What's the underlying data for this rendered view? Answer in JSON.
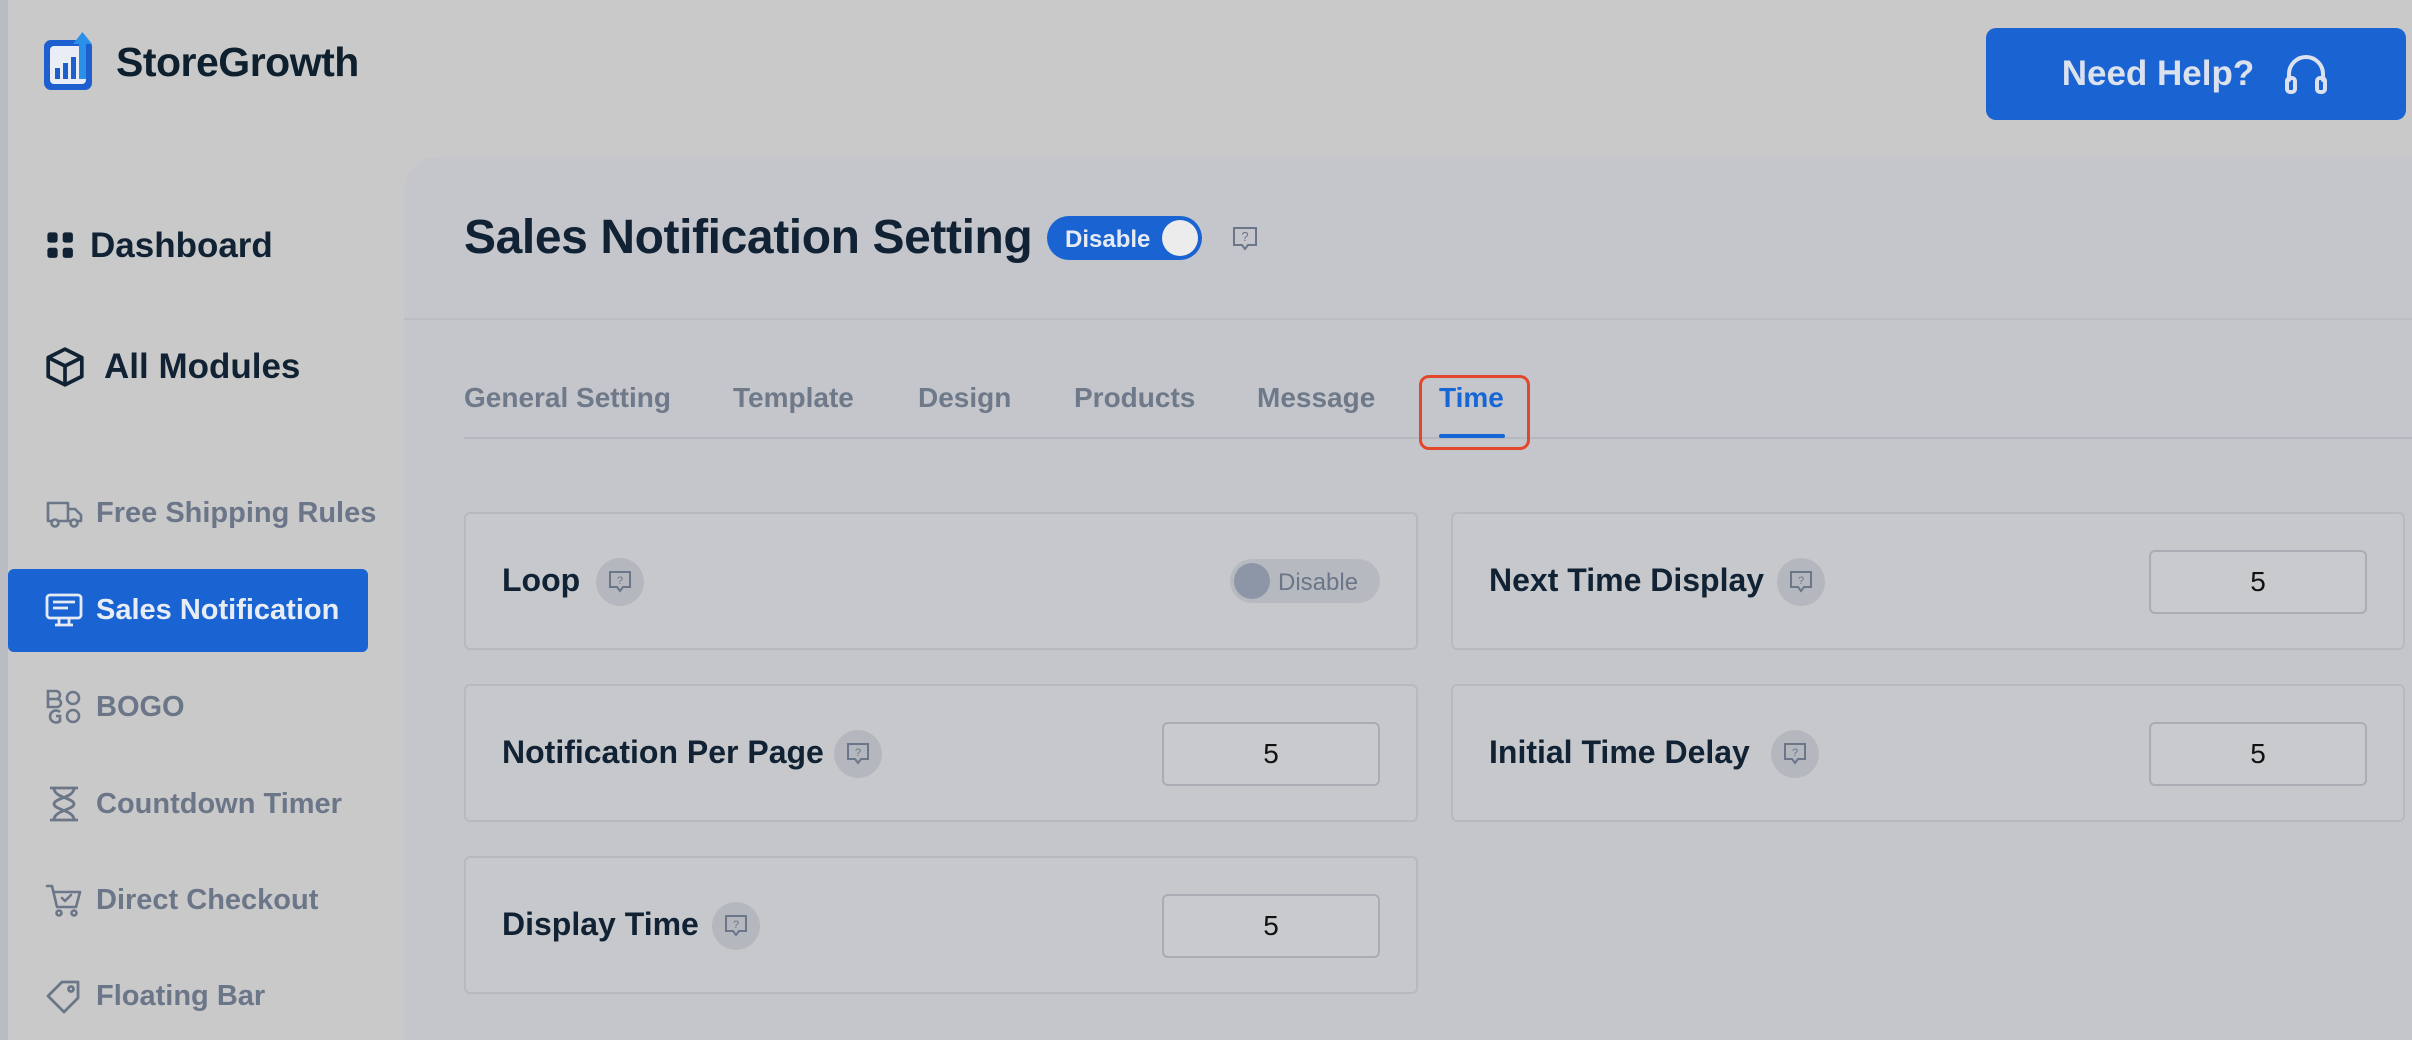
{
  "brand": {
    "name": "StoreGrowth",
    "accent": "#1a63d3"
  },
  "header": {
    "help_label": "Need Help?",
    "help_icon": "headset-icon"
  },
  "sidebar": {
    "dashboard": "Dashboard",
    "all_modules": "All Modules",
    "items": [
      {
        "label": "Free Shipping Rules",
        "icon": "truck-icon"
      },
      {
        "label": "Sales Notification",
        "icon": "monitor-icon",
        "active": true
      },
      {
        "label": "BOGO",
        "icon": "bogo-icon"
      },
      {
        "label": "Countdown Timer",
        "icon": "hourglass-icon"
      },
      {
        "label": "Direct Checkout",
        "icon": "cart-icon"
      },
      {
        "label": "Floating Bar",
        "icon": "tag-icon"
      }
    ]
  },
  "page": {
    "title": "Sales Notification Setting",
    "module_toggle_label": "Disable"
  },
  "tabs": [
    {
      "label": "General Setting"
    },
    {
      "label": "Template"
    },
    {
      "label": "Design"
    },
    {
      "label": "Products"
    },
    {
      "label": "Message"
    },
    {
      "label": "Time",
      "active": true
    }
  ],
  "settings": {
    "loop": {
      "label": "Loop",
      "toggle_label": "Disable"
    },
    "next_time_display": {
      "label": "Next Time Display",
      "value": "5"
    },
    "notification_per_page": {
      "label": "Notification Per Page",
      "value": "5"
    },
    "initial_time_delay": {
      "label": "Initial Time Delay",
      "value": "5"
    },
    "display_time": {
      "label": "Display Time",
      "value": "5"
    }
  }
}
